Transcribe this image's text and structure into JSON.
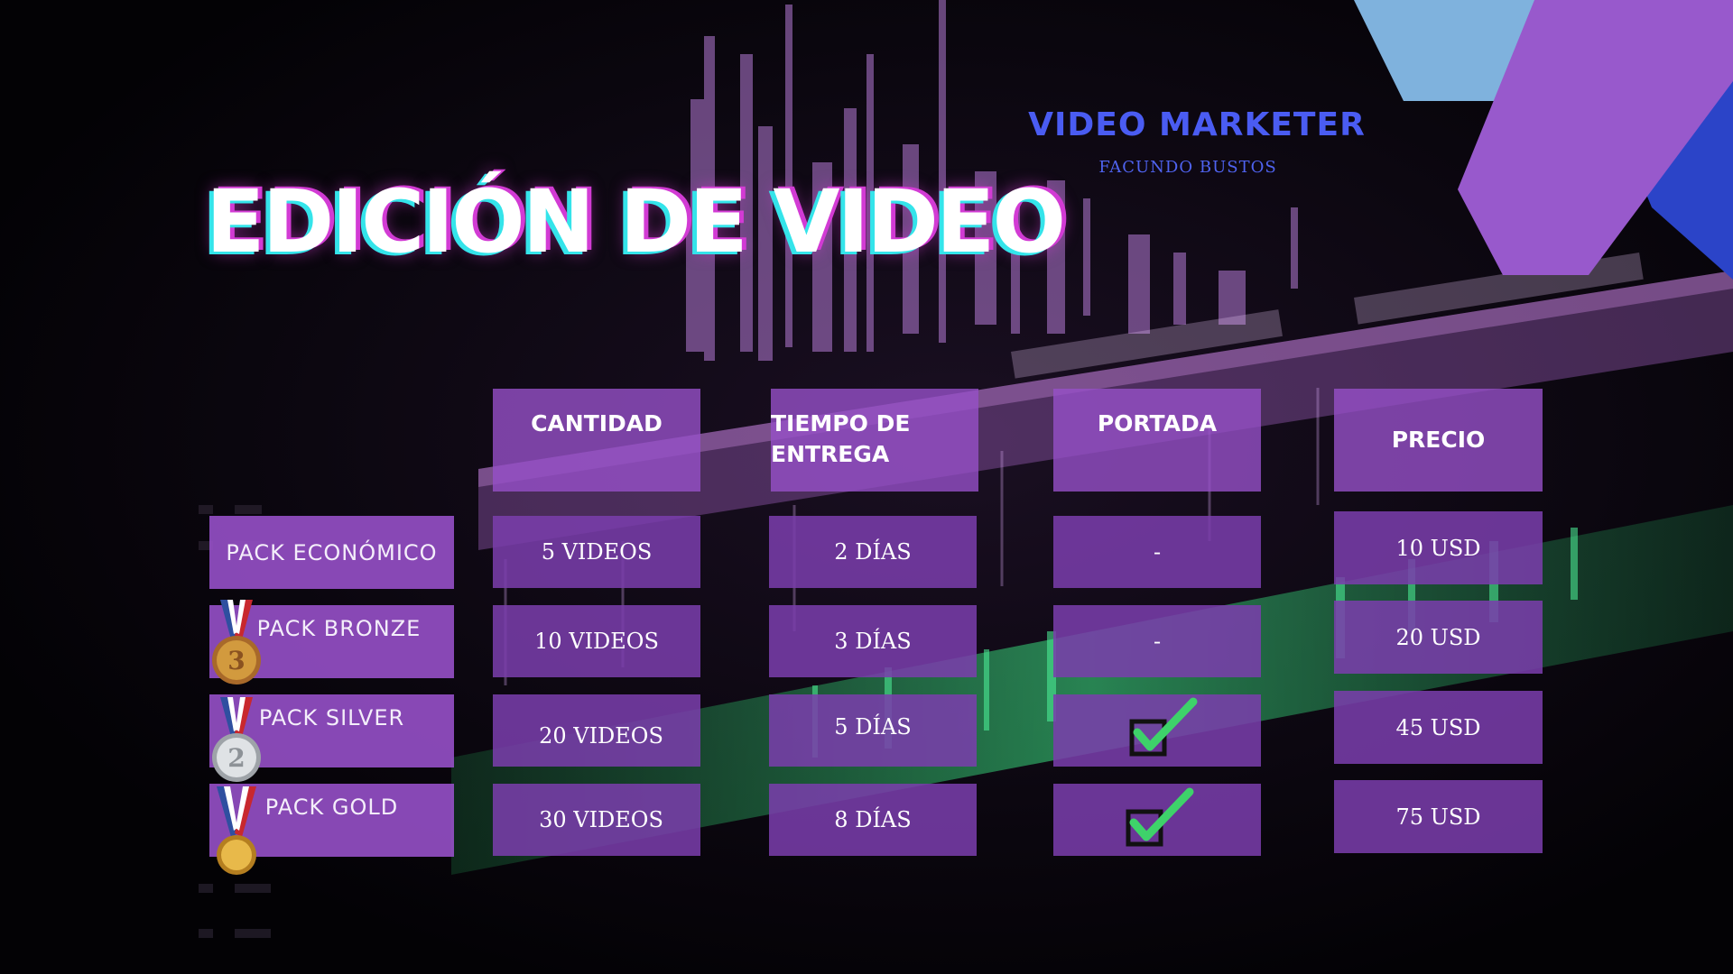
{
  "title": "EDICIÓN DE VIDEO",
  "brand": {
    "name": "VIDEO MARKETER",
    "author": "FACUNDO BUSTOS"
  },
  "colors": {
    "accent": "#9b5bd3",
    "brand_blue": "#4a5cf2",
    "check_green": "#3ed26a"
  },
  "table": {
    "headers": {
      "quantity": "CANTIDAD",
      "delivery_line1": "TIEMPO DE",
      "delivery_line2": "ENTREGA",
      "cover": "PORTADA",
      "price": "PRECIO"
    },
    "rows": [
      {
        "pack": "PACK ECONÓMICO",
        "medal": "none",
        "quantity": "5 VIDEOS",
        "delivery": "2 DÍAS",
        "cover": "-",
        "price": "10 USD"
      },
      {
        "pack": "PACK BRONZE",
        "medal": "bronze-medal-icon",
        "quantity": "10 VIDEOS",
        "delivery": "3 DÍAS",
        "cover": "-",
        "price": "20 USD"
      },
      {
        "pack": "PACK SILVER",
        "medal": "silver-medal-icon",
        "quantity": "20 VIDEOS",
        "delivery": "5 DÍAS",
        "cover": "check-icon",
        "price": "45 USD"
      },
      {
        "pack": "PACK GOLD",
        "medal": "gold-medal-icon",
        "quantity": "30 VIDEOS",
        "delivery": "8 DÍAS",
        "cover": "check-icon",
        "price": "75 USD"
      }
    ]
  }
}
